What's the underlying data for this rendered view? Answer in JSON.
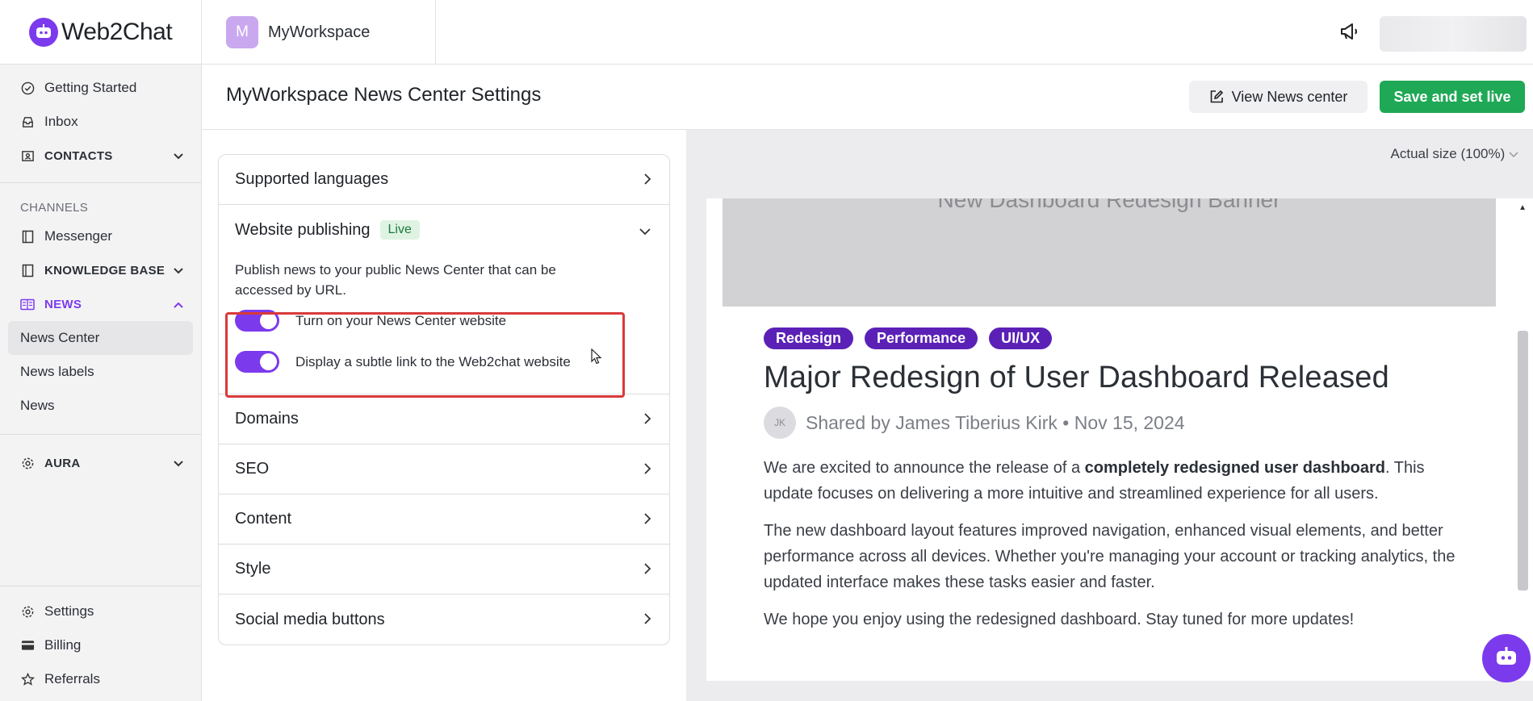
{
  "brand": {
    "name": "Web2Chat",
    "accent": "#7c3aed",
    "logo_icon": "chat-bot-icon"
  },
  "workspace": {
    "initial": "M",
    "name": "MyWorkspace"
  },
  "sidebar": {
    "items": [
      {
        "label": "Getting Started",
        "icon": "check-circle-icon"
      },
      {
        "label": "Inbox",
        "icon": "inbox-icon"
      },
      {
        "label": "CONTACTS",
        "icon": "contacts-icon"
      }
    ],
    "channels_heading": "CHANNELS",
    "channel_items": [
      {
        "label": "Messenger",
        "icon": "book-icon"
      },
      {
        "label": "KNOWLEDGE BASE",
        "icon": "book-icon"
      },
      {
        "label": "NEWS",
        "icon": "news-icon"
      }
    ],
    "news_sub": [
      "News Center",
      "News labels",
      "News"
    ],
    "aura": {
      "label": "AURA",
      "icon": "gear-icon"
    },
    "bottom": [
      {
        "label": "Settings",
        "icon": "gear-icon"
      },
      {
        "label": "Billing",
        "icon": "card-icon"
      },
      {
        "label": "Referrals",
        "icon": "star-icon"
      }
    ]
  },
  "header": {
    "title": "MyWorkspace News Center Settings",
    "view_label": "View News center",
    "save_label": "Save and set live",
    "save_color": "#1fa855"
  },
  "settings": {
    "supported_languages": "Supported languages",
    "website_publishing": "Website publishing",
    "live_badge": "Live",
    "publish_desc": "Publish news to your public News Center that can be accessed by URL.",
    "toggle1": "Turn on your News Center website",
    "toggle2": "Display a subtle link to the Web2chat website",
    "domains": "Domains",
    "seo": "SEO",
    "content": "Content",
    "style": "Style",
    "social": "Social media buttons"
  },
  "preview": {
    "zoom": "Actual size (100%)",
    "banner_text": "New Dashboard Redesign Banner",
    "tags": [
      "Redesign",
      "Performance",
      "UI/UX"
    ],
    "title": "Major Redesign of User Dashboard Released",
    "author_initials": "JK",
    "byline": "Shared by James Tiberius Kirk • Nov 15, 2024",
    "p1_a": "We are excited to announce the release of a ",
    "p1_b": "completely redesigned user dashboard",
    "p1_c": ". This update focuses on delivering a more intuitive and streamlined experience for all users.",
    "p2": "The new dashboard layout features improved navigation, enhanced visual elements, and better performance across all devices. Whether you're managing your account or tracking analytics, the updated interface makes these tasks easier and faster.",
    "p3": "We hope you enjoy using the redesigned dashboard. Stay tuned for more updates!"
  }
}
